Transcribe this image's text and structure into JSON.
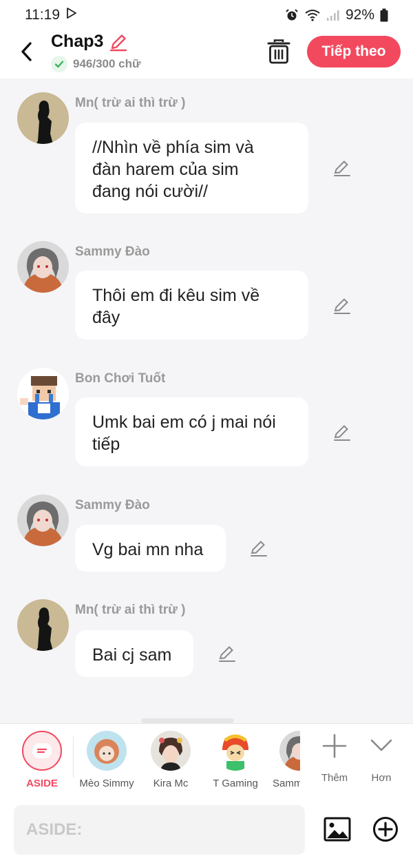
{
  "status": {
    "time": "11:19",
    "battery": "92%"
  },
  "header": {
    "title": "Chap3",
    "word_count": "946/300 chữ",
    "next_label": "Tiếp theo"
  },
  "messages": [
    {
      "name": "Mn( trừ ai thì trừ )",
      "lines": [
        "//Nhìn về phía sim và",
        "đàn harem của sim",
        "đang nói cười//"
      ]
    },
    {
      "name": "Sammy Đào",
      "lines": [
        "Thôi em đi kêu sim về",
        "đây"
      ]
    },
    {
      "name": "Bon Chơi Tuốt",
      "lines": [
        "Umk bai em có j mai nói",
        "tiếp"
      ]
    },
    {
      "name": "Sammy Đào",
      "lines": [
        "Vg bai mn nha"
      ]
    },
    {
      "name": "Mn( trừ ai thì trừ )",
      "lines": [
        "Bai cj sam"
      ]
    }
  ],
  "characters": [
    {
      "label": "ASIDE"
    },
    {
      "label": "Mèo Simmy"
    },
    {
      "label": "Kira Mc"
    },
    {
      "label": "T Gaming"
    },
    {
      "label": "Samm"
    }
  ],
  "tools": {
    "add_label": "Thêm",
    "more_label": "Hơn"
  },
  "input": {
    "placeholder": "ASIDE:"
  },
  "colors": {
    "accent": "#f2495f",
    "background": "#f5f5f7"
  }
}
